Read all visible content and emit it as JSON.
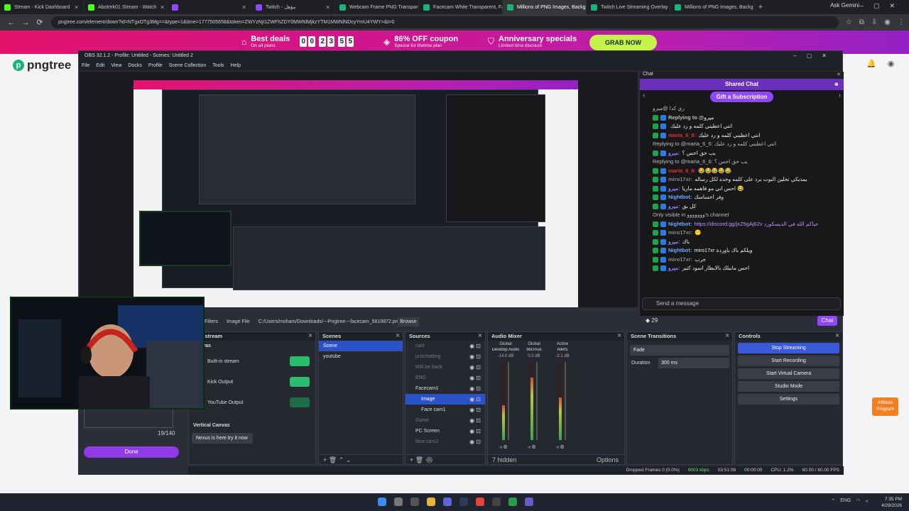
{
  "browser": {
    "tabs": [
      {
        "title": "Stream - Kick Dashboard",
        "color": "#53fc18"
      },
      {
        "title": "Abotrek01 Stream - Watch",
        "color": "#53fc18"
      },
      {
        "title": "",
        "color": "#9147ff"
      },
      {
        "title": "Twitch - مؤهل",
        "color": "#9147ff"
      },
      {
        "title": "Webcam Frame PNG Transparent",
        "color": "#19b27b"
      },
      {
        "title": "Facecam White Transparent, Fa",
        "color": "#19b27b"
      },
      {
        "title": "Millions of PNG Images, Backgr",
        "color": "#19b27b"
      },
      {
        "title": "Twitch Live Streaming Overlay",
        "color": "#19b27b"
      },
      {
        "title": "Millions of PNG Images, Backgr",
        "color": "#19b27b"
      }
    ],
    "ask_gemini": "Ask Gemini",
    "url": "pngtree.com/element/down?id=NTgxOTg3Mg==&type=1&time=1777505658&token=ZWYzNjI1ZWFhZDY0MWNlMjkzYTM1MWNlNDcyYmU4YWY=&t=0"
  },
  "promo": {
    "best_deals": "Best deals",
    "best_deals_sub": "On all plans",
    "countdown": [
      "0",
      "0",
      "2",
      "3",
      "5",
      "5"
    ],
    "coupon": "86% OFF coupon",
    "coupon_sub": "Special for lifetime plan",
    "anniv": "Anniversary specials",
    "anniv_sub": "Limited time discount",
    "grab": "GRAB NOW"
  },
  "pngtree": {
    "logo": "pngtree"
  },
  "obs": {
    "title": "OBS 32.1.2 - Profile: Untitled - Scenes: Untitled 2",
    "menu": [
      "File",
      "Edit",
      "View",
      "Docks",
      "Profile",
      "Scene Collection",
      "Tools",
      "Help"
    ],
    "chat": {
      "dock_title": "Chat",
      "shared_chat": "Shared Chat",
      "gift": "Gift a Subscription",
      "messages": [
        {
          "type": "reply",
          "text": "زي كدا @ميرو"
        },
        {
          "type": "msg",
          "user": "Replying to @ميرو",
          "color": "#bbb",
          "text": ""
        },
        {
          "type": "msg",
          "user": "",
          "color": "#eee",
          "text": "انتي اعطيني كلمه و رد عليك"
        },
        {
          "type": "msg",
          "user": "maria_6_6:",
          "color": "#e8312f",
          "text": "انتي اعطيني كلمه و رد عليك"
        },
        {
          "type": "reply",
          "text": "Replying to @maria_6_6: انتي اعطيني كلمه و رد عليك"
        },
        {
          "type": "msg",
          "user": "ميرو:",
          "color": "#8a7fff",
          "text": "يب حق احس ؟"
        },
        {
          "type": "reply",
          "text": "Replying to @maria_6_6: يب حق احس ؟"
        },
        {
          "type": "msg",
          "user": "maria_6_6:",
          "color": "#e8312f",
          "text": "😂😂😂😂😂"
        },
        {
          "type": "msg",
          "user": "miro17xr:",
          "color": "#888",
          "text": "يمديكي تخلين البوت يرد على كلمه وحده لكل رساله"
        },
        {
          "type": "msg",
          "user": "ميرو:",
          "color": "#8a7fff",
          "text": "احس اني مو قاهمه ماريا 😂"
        },
        {
          "type": "msg",
          "user": "Nightbot:",
          "color": "#6fa8ff",
          "text": "وفر احساسك"
        },
        {
          "type": "msg",
          "user": "ميرو:",
          "color": "#8a7fff",
          "text": "كل بق"
        },
        {
          "type": "reply",
          "text": "Only visible in ووووووو's channel"
        },
        {
          "type": "msg",
          "user": "Nightbot:",
          "color": "#6fa8ff",
          "text": "https://discord.gg/jxZ5gAj62v حياكم الله في الديسكورد"
        },
        {
          "type": "msg",
          "user": "miro17xr:",
          "color": "#888",
          "text": "😶"
        },
        {
          "type": "msg",
          "user": "ميرو:",
          "color": "#8a7fff",
          "text": "باك"
        },
        {
          "type": "msg",
          "user": "Nightbot:",
          "color": "#6fa8ff",
          "text": "miro17xr ويلكم باك ياوردة"
        },
        {
          "type": "msg",
          "user": "miro17xr:",
          "color": "#888",
          "text": "جرب"
        },
        {
          "type": "msg",
          "user": "ميرو:",
          "color": "#8a7fff",
          "text": "احس مابيلك بالايطار اسود كثير"
        },
        {
          "type": "msg",
          "user": "Nightbot:",
          "color": "#6fa8ff",
          "text": "وفر احساسك"
        }
      ],
      "send_placeholder": "Send a message",
      "points": "29",
      "chat_btn": "Chat"
    },
    "file_bar": {
      "tab": "Filters",
      "label": "Image File",
      "path": "C:/Users/moham/Downloads/---Pngtree---facecam_5819872.png",
      "browse": "Browse"
    },
    "multistream": {
      "title": "Multistream",
      "canvas": "Canvas",
      "outputs": [
        "Built-in stream",
        "Kick Output",
        "YouTube Output"
      ],
      "vertical": "Vertical Canvas",
      "vertical_item": "Nexus is here try it now"
    },
    "scenes": {
      "title": "Scenes",
      "items": [
        "Scene",
        "youtube"
      ]
    },
    "sources": {
      "title": "Sources",
      "items": [
        "cast",
        "justchatting",
        "Will be back",
        "END",
        "Facecam1",
        "Image",
        "Face cam1",
        "Game",
        "PC Screen",
        "face cam2"
      ]
    },
    "mixer": {
      "title": "Audio Mixer",
      "channels": [
        {
          "name": "Desktop Audio",
          "db": "-14.0 dB",
          "head": "Global"
        },
        {
          "name": "Mic/Aux",
          "db": "0.0 dB",
          "head": "Global"
        },
        {
          "name": "Alerts",
          "db": "-3.1 dB",
          "head": "Active"
        }
      ],
      "hidden": "7 hidden",
      "options": "Options"
    },
    "transitions": {
      "title": "Scene Transitions",
      "fade": "Fade",
      "duration_label": "Duration",
      "duration": "300 ms"
    },
    "controls": {
      "title": "Controls",
      "buttons": [
        "Stop Streaming",
        "Start Recording",
        "Start Virtual Camera",
        "Studio Mode",
        "Settings"
      ]
    },
    "status": {
      "dropped": "Dropped Frames 0 (0.0%)",
      "kbps": "6003 kbps",
      "live": "03:51:08",
      "rec": "00:00:00",
      "cpu": "CPU: 1.2%",
      "fps": "60.00 / 60.00 FPS"
    },
    "side_panel": {
      "count": "19/140",
      "done": "Done"
    }
  },
  "affiliate": "Affiliate Program",
  "taskbar": {
    "lang": "ENG",
    "time": "7:35 PM",
    "date": "4/29/2026"
  }
}
